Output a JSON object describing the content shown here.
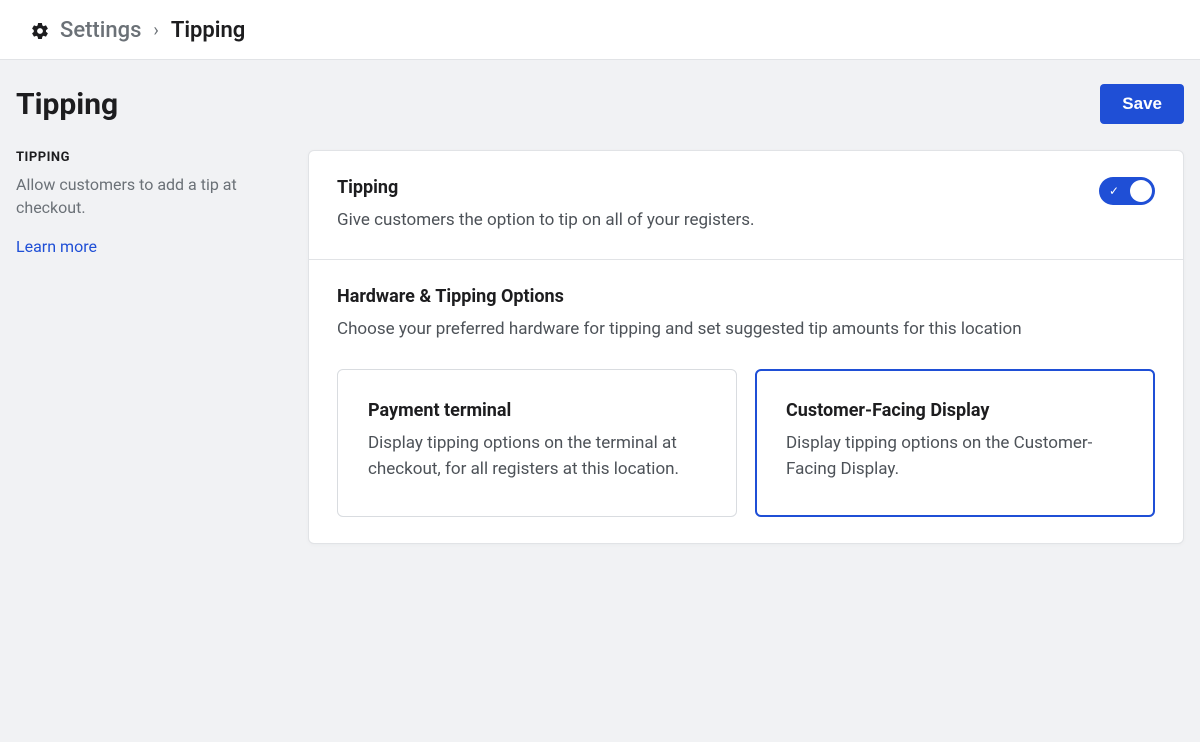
{
  "breadcrumb": {
    "parent": "Settings",
    "separator": "›",
    "current": "Tipping"
  },
  "header": {
    "title": "Tipping",
    "save_label": "Save"
  },
  "sidebar": {
    "heading": "TIPPING",
    "description": "Allow customers to add a tip at checkout.",
    "learn_more_label": "Learn more"
  },
  "tipping_section": {
    "title": "Tipping",
    "subtitle": "Give customers the option to tip on all of your registers.",
    "enabled": true
  },
  "hardware_section": {
    "title": "Hardware & Tipping Options",
    "subtitle": "Choose your preferred hardware for tipping and set suggested tip amounts for this location",
    "options": [
      {
        "id": "payment-terminal",
        "title": "Payment terminal",
        "description": "Display tipping options on the terminal at checkout, for all registers at this location.",
        "selected": false
      },
      {
        "id": "customer-facing-display",
        "title": "Customer-Facing Display",
        "description": "Display tipping options on the Customer-Facing Display.",
        "selected": true
      }
    ]
  }
}
